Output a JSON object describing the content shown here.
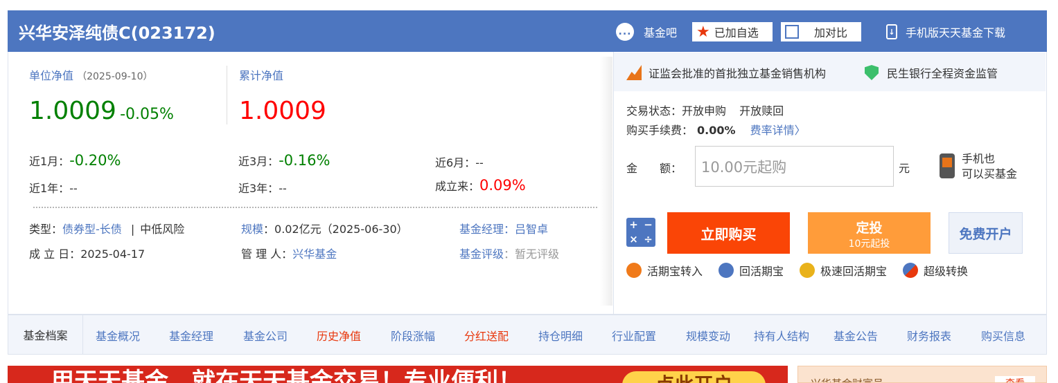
{
  "header": {
    "fund_title": "兴华安泽纯债C(023172)",
    "fund_bar_label": "基金吧",
    "fund_bar_icon": "...",
    "favorite_label": "已加自选",
    "compare_label": "加对比",
    "app_download_label": "手机版天天基金下载"
  },
  "nav_values": {
    "unit_nav_label": "单位净值",
    "unit_nav_date": "（2025-09-10）",
    "unit_nav_value": "1.0009",
    "unit_nav_change": "-0.05%",
    "acc_nav_label": "累计净值",
    "acc_nav_value": "1.0009"
  },
  "performance": [
    {
      "label": "近1月：",
      "value": "-0.20%"
    },
    {
      "label": "近3月：",
      "value": "-0.16%"
    },
    {
      "label": "近6月：",
      "value": "--"
    },
    {
      "label": "近1年：",
      "value": "--"
    },
    {
      "label": "近3年：",
      "value": "--"
    },
    {
      "label": "成立来：",
      "value": "0.09%"
    }
  ],
  "info": {
    "type_label": "类型：",
    "type_value": "债券型-长债",
    "type_sep": "|",
    "risk_value": "中低风险",
    "scale_label": "规模",
    "scale_value": "：0.02亿元（2025-06-30）",
    "manager_label": "基金经理：",
    "manager_value": "吕智卓",
    "established_label": "成 立 日：",
    "established_value": "2025-04-17",
    "company_label": "管 理 人：",
    "company_value": "兴华基金",
    "rating_label": "基金评级",
    "rating_value": "：暂无评级"
  },
  "trust": {
    "item1": "证监会批准的首批独立基金销售机构",
    "item2": "民生银行全程资金监管"
  },
  "trade": {
    "status_label": "交易状态：",
    "status_purchase": "开放申购",
    "status_redeem": "开放赎回",
    "fee_label": "购买手续费：",
    "fee_value": "0.00%",
    "fee_detail_link": "费率详情〉",
    "amount_label": "金　　额：",
    "amount_placeholder": "10.00元起购",
    "amount_unit": "元",
    "mobile_line1": "手机也",
    "mobile_line2": "可以买基金",
    "calc_glyphs": [
      "+",
      "−",
      "×",
      "÷"
    ],
    "buy_label": "立即购买",
    "sip_label": "定投",
    "sip_sub": "10元起投",
    "open_account_label": "免费开户",
    "actions": [
      "活期宝转入",
      "回活期宝",
      "极速回活期宝",
      "超级转换"
    ]
  },
  "nav_bar": {
    "first": "基金档案",
    "items": [
      "基金概况",
      "基金经理",
      "基金公司",
      "历史净值",
      "阶段涨幅",
      "分红送配",
      "持仓明细",
      "行业配置",
      "规模变动",
      "持有人结构",
      "基金公告",
      "财务报表",
      "购买信息"
    ]
  },
  "banners": {
    "left_text": "用天天基金，就在天天基金交易！专业便利！",
    "left_button": "点此开户",
    "right_text": "兴华基金财富号",
    "right_tag": "查看"
  },
  "colors": {
    "header_bg": "#4d76c0",
    "up_red": "#ff0000",
    "down_green": "#008000",
    "buy_orange": "#fa4506",
    "sip_orange": "#ff9c3a"
  }
}
